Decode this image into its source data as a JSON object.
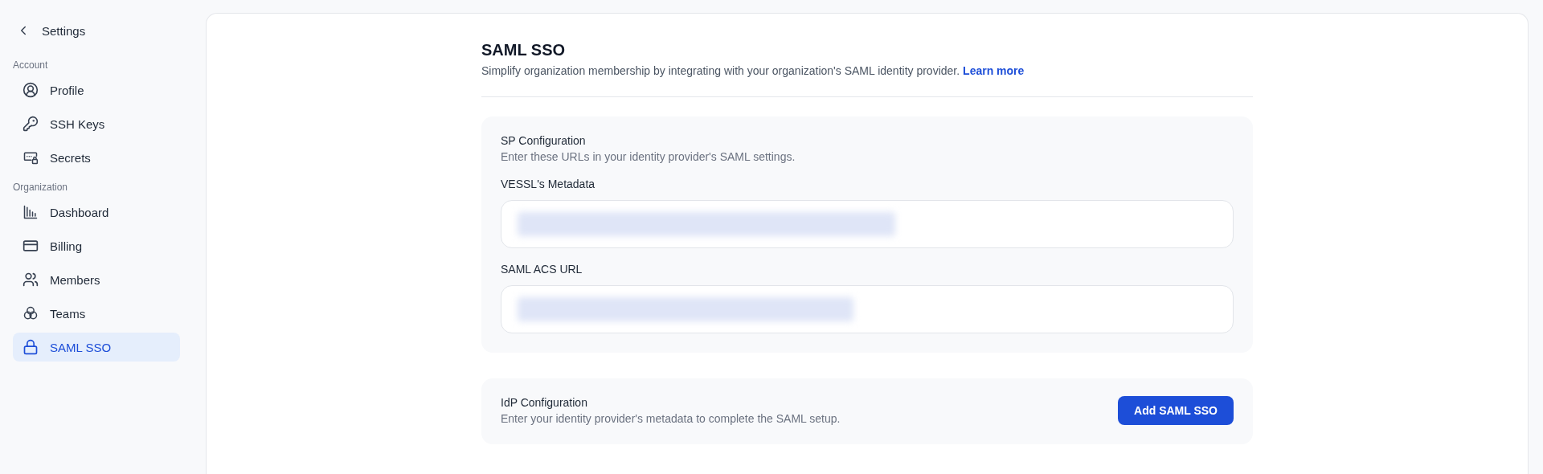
{
  "sidebar": {
    "back": {
      "label": "Settings"
    },
    "sections": [
      {
        "title": "Account",
        "items": [
          {
            "label": "Profile",
            "kind": "profile",
            "selected": false
          },
          {
            "label": "SSH Keys",
            "kind": "key",
            "selected": false
          },
          {
            "label": "Secrets",
            "kind": "secrets",
            "selected": false
          }
        ]
      },
      {
        "title": "Organization",
        "items": [
          {
            "label": "Dashboard",
            "kind": "dashboard",
            "selected": false
          },
          {
            "label": "Billing",
            "kind": "billing",
            "selected": false
          },
          {
            "label": "Members",
            "kind": "members",
            "selected": false
          },
          {
            "label": "Teams",
            "kind": "teams",
            "selected": false
          },
          {
            "label": "SAML SSO",
            "kind": "lock",
            "selected": true
          }
        ]
      }
    ]
  },
  "page": {
    "title": "SAML SSO",
    "description": "Simplify organization membership by integrating with your organization's SAML identity provider.",
    "link": "Learn more"
  },
  "sp_configuration": {
    "title": "SP Configuration",
    "description": "Enter these URLs in your identity provider's SAML settings.",
    "fields": [
      {
        "label": "VESSL's Metadata",
        "redacted": true
      },
      {
        "label": "SAML ACS URL",
        "redacted": true
      }
    ]
  },
  "idp_configuration": {
    "title": "IdP Configuration",
    "description": "Enter your identity provider's metadata to complete the SAML setup.",
    "button": "Add SAML SSO"
  }
}
